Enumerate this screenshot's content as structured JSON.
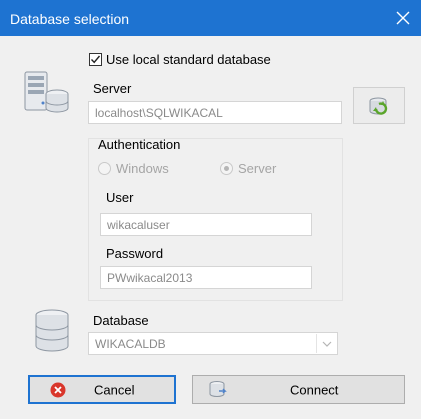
{
  "window": {
    "title": "Database selection"
  },
  "options": {
    "use_local_label": "Use local standard database",
    "use_local_checked": true
  },
  "server": {
    "label": "Server",
    "value": "localhost\\SQLWIKACAL"
  },
  "auth": {
    "label": "Authentication",
    "windows_label": "Windows",
    "server_label": "Server",
    "selected": "Server"
  },
  "user": {
    "label": "User",
    "value": "wikacaluser"
  },
  "password": {
    "label": "Password",
    "value": "PWwikacal2013"
  },
  "database": {
    "label": "Database",
    "value": "WIKACALDB"
  },
  "buttons": {
    "cancel_label": "Cancel",
    "connect_label": "Connect"
  },
  "icons": {
    "server": "server-icon",
    "database": "database-icon",
    "refresh": "refresh-icon",
    "cancel": "cancel-icon",
    "connect": "connect-icon",
    "close": "close-icon"
  },
  "colors": {
    "titlebar": "#1e73d1",
    "focus": "#1e73d1",
    "cancel_icon": "#d9362b",
    "refresh_icon": "#5aa52a"
  }
}
